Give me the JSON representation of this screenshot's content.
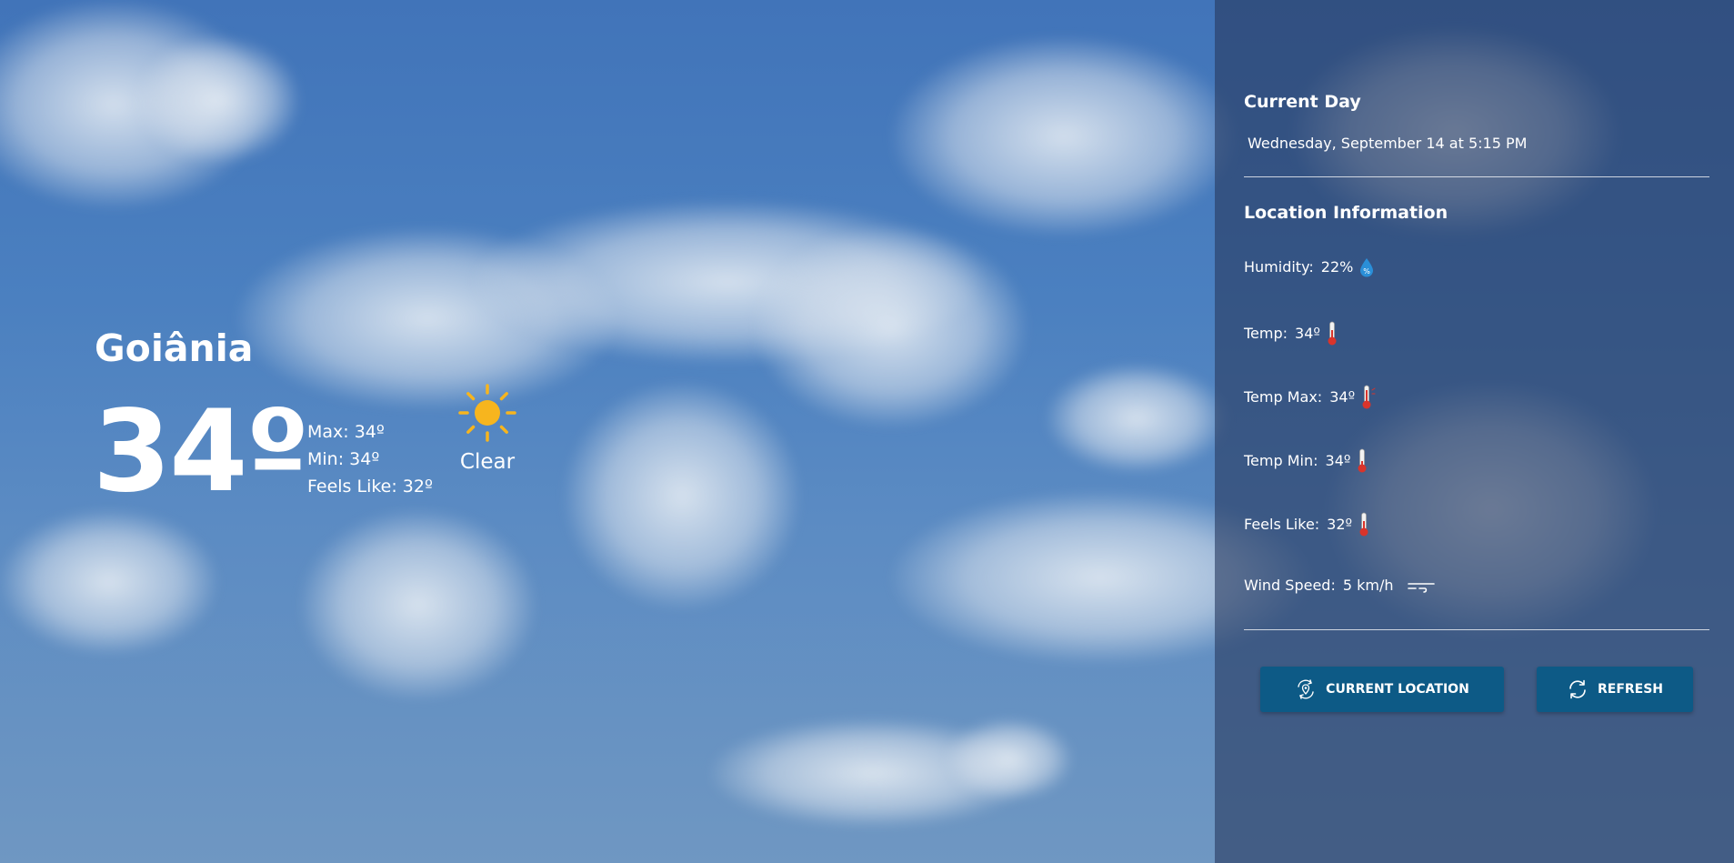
{
  "location": {
    "city": "Goiânia",
    "temperature": "34º",
    "max": "Max: 34º",
    "min": "Min: 34º",
    "feels_like": "Feels Like: 32º",
    "condition": "Clear",
    "condition_icon": "sun-icon"
  },
  "panel": {
    "current_day_title": "Current Day",
    "date_time": "Wednesday, September 14 at 5:15 PM",
    "location_info_title": "Location Information",
    "rows": [
      {
        "label": "Humidity:",
        "value": "22%",
        "icon": "humidity-drop-icon"
      },
      {
        "label": "Temp:",
        "value": "34º",
        "icon": "thermometer-icon"
      },
      {
        "label": "Temp Max:",
        "value": "34º",
        "icon": "thermometer-hot-icon"
      },
      {
        "label": "Temp Min:",
        "value": "34º",
        "icon": "thermometer-cold-icon"
      },
      {
        "label": "Feels Like:",
        "value": "32º",
        "icon": "thermometer-icon"
      },
      {
        "label": "Wind Speed:",
        "value": "5 km/h",
        "icon": "wind-icon"
      }
    ],
    "buttons": {
      "current_location": "CURRENT LOCATION",
      "refresh": "REFRESH"
    }
  },
  "colors": {
    "sky": "#4174b9",
    "panel": "#283a5f",
    "button": "#0d5a86",
    "sun": "#f7b51e",
    "thermometer": "#d9342b",
    "drop": "#2a8fd8"
  }
}
